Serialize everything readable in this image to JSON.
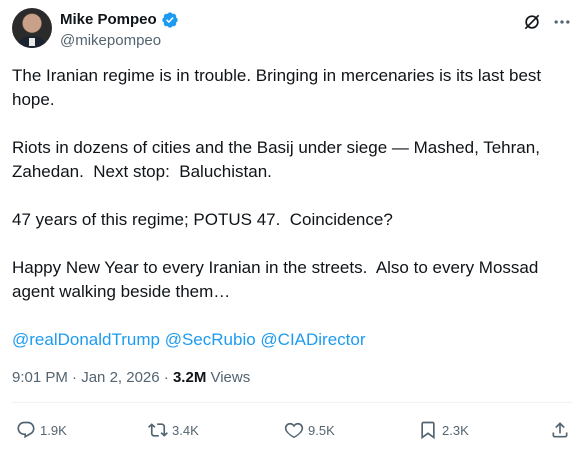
{
  "author": {
    "display_name": "Mike Pompeo",
    "handle": "@mikepompeo",
    "verified_color": "#1d9bf0"
  },
  "header_icons": [
    "grok-icon",
    "more-icon"
  ],
  "tweet": {
    "paragraphs": [
      "The Iranian regime is in trouble. Bringing in mercenaries is its last best hope.",
      "Riots in dozens of cities and the Basij under siege — Mashed, Tehran, Zahedan.  Next stop:  Baluchistan.",
      "47 years of this regime; POTUS 47.  Coincidence?",
      "Happy New Year to every Iranian in the streets.  Also to every Mossad agent walking beside them…"
    ],
    "mentions": [
      "@realDonaldTrump",
      "@SecRubio",
      "@CIADirector"
    ]
  },
  "meta": {
    "time": "9:01 PM",
    "separator": " · ",
    "date": "Jan 2, 2026",
    "views_count": "3.2M",
    "views_label": " Views"
  },
  "actions": {
    "reply_count": "1.9K",
    "retweet_count": "3.4K",
    "like_count": "9.5K",
    "bookmark_count": "2.3K"
  },
  "colors": {
    "text": "#0f1419",
    "secondary": "#536471",
    "link": "#1d9bf0"
  }
}
